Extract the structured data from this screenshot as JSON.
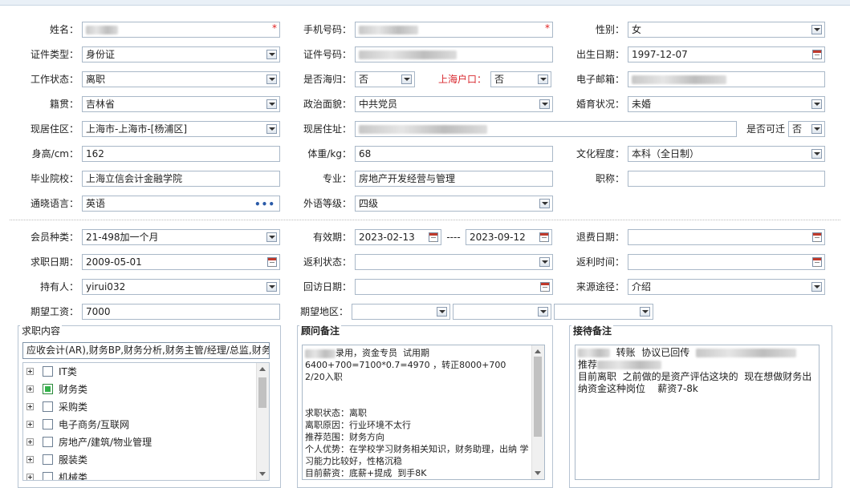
{
  "labels": {
    "name": "姓名：",
    "phone": "手机号码：",
    "gender": "性别：",
    "id_type": "证件类型：",
    "id_no": "证件号码：",
    "birth": "出生日期：",
    "work_status": "工作状态：",
    "returnee": "是否海归：",
    "sh_hukou": "上海户口：",
    "email": "电子邮箱：",
    "native": "籍贯：",
    "political": "政治面貌：",
    "marital": "婚育状况：",
    "residence": "现居住区：",
    "address": "现居住址：",
    "relocate": "是否可迁",
    "height": "身高/cm：",
    "weight": "体重/kg：",
    "education": "文化程度：",
    "school": "毕业院校：",
    "major": "专业：",
    "title": "职称：",
    "languages": "通晓语言：",
    "fl_level": "外语等级：",
    "member_type": "会员种类：",
    "validity": "有效期：",
    "refund_date": "退费日期：",
    "job_date": "求职日期：",
    "rebate_status": "返利状态：",
    "rebate_time": "返利时间：",
    "holder": "持有人：",
    "visit_date": "回访日期：",
    "source": "来源途径：",
    "salary": "期望工资：",
    "region": "期望地区："
  },
  "values": {
    "gender": "女",
    "id_type": "身份证",
    "birth": "1997-12-07",
    "work_status": "离职",
    "returnee": "否",
    "sh_hukou": "否",
    "native": "吉林省",
    "political": "中共党员",
    "marital": "未婚",
    "residence": "上海市-上海市-[杨浦区]",
    "relocate": "否",
    "height": "162",
    "weight": "68",
    "education": "本科（全日制）",
    "school": "上海立信会计金融学院",
    "major": "房地产开发经营与管理",
    "title": "",
    "languages": "英语",
    "fl_level": "四级",
    "member_type": "21-498加一个月",
    "validity_from": "2023-02-13",
    "validity_sep": "----",
    "validity_to": "2023-09-12",
    "refund_date": "",
    "job_date": "2009-05-01",
    "rebate_status": "",
    "rebate_time": "",
    "holder": "yirui032",
    "visit_date": "",
    "source": "介绍",
    "salary": "7000",
    "region1": "",
    "region2": "",
    "region3": ""
  },
  "required_mark": "*",
  "job": {
    "title": "求职内容",
    "selected": "应收会计(AR),财务BP,财务分析,财务主管/经理/总监,财务",
    "tree": [
      {
        "label": "IT类",
        "checked": false
      },
      {
        "label": "财务类",
        "checked": true
      },
      {
        "label": "采购类",
        "checked": false
      },
      {
        "label": "电子商务/互联网",
        "checked": false
      },
      {
        "label": "房地产/建筑/物业管理",
        "checked": false
      },
      {
        "label": "服装类",
        "checked": false
      },
      {
        "label": "机械类",
        "checked": false
      }
    ]
  },
  "advisor": {
    "title": "顾问备注",
    "lines": [
      "录用，资金专员  试用期",
      "6400+700=7100*0.7=4970 ，转正8000+700  2/20入职",
      "",
      "",
      "求职状态：离职",
      "离职原因：行业环境不太行",
      "推荐范围：财务方向",
      "个人优势：在学校学习财务相关知识，财务助理，出纳 学习能力比较好，性格沉稳",
      "目前薪资：底薪+提成  到手8K"
    ]
  },
  "reception": {
    "title": "接待备注",
    "line1_text": "转账  协议已回传",
    "line2_text": "推荐",
    "lines": [
      "目前离职  之前做的是资产评估这块的  现在想做财务出纳资金这种岗位    薪资7-8k"
    ]
  }
}
